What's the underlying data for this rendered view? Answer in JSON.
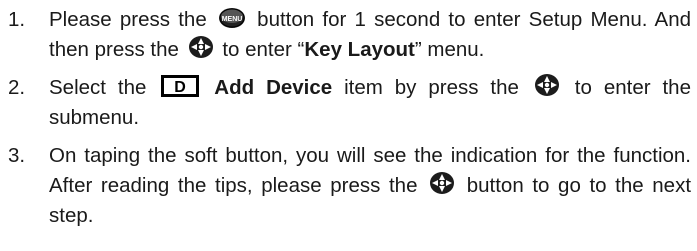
{
  "steps": [
    {
      "number": "1.",
      "parts": {
        "a": "Please press the",
        "b": "button for 1 second to enter Setup Menu. And then press the",
        "c": "to enter “",
        "kw": "Key Layout",
        "d": "” menu."
      },
      "icons": [
        "menu-button-icon",
        "ok-button-icon"
      ]
    },
    {
      "number": "2.",
      "parts": {
        "a": "Select the",
        "kw": "Add Device",
        "b": "item by press the",
        "c": "to enter the submenu."
      },
      "icons": [
        "device-d-icon",
        "ok-button-icon"
      ],
      "device_icon_letter": "D"
    },
    {
      "number": "3.",
      "parts": {
        "a": "On taping the soft button, you will see the indication for the function. After reading the tips, please press the",
        "b": "button to go to the next step."
      },
      "icons": [
        "ok-button-icon"
      ]
    }
  ],
  "menu_icon_label": "MENU"
}
